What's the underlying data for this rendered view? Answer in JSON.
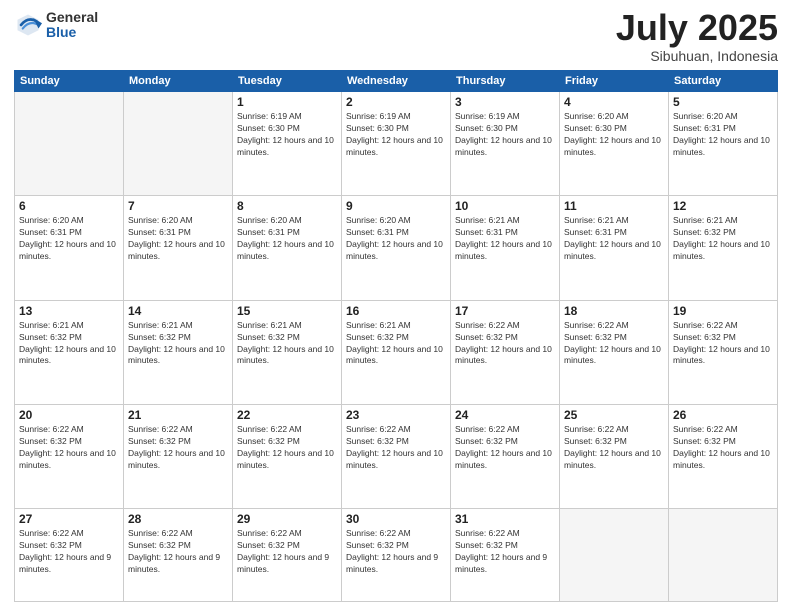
{
  "logo": {
    "general": "General",
    "blue": "Blue"
  },
  "header": {
    "month": "July 2025",
    "location": "Sibuhuan, Indonesia"
  },
  "days_of_week": [
    "Sunday",
    "Monday",
    "Tuesday",
    "Wednesday",
    "Thursday",
    "Friday",
    "Saturday"
  ],
  "weeks": [
    [
      {
        "day": "",
        "info": ""
      },
      {
        "day": "",
        "info": ""
      },
      {
        "day": "1",
        "info": "Sunrise: 6:19 AM\nSunset: 6:30 PM\nDaylight: 12 hours and 10 minutes."
      },
      {
        "day": "2",
        "info": "Sunrise: 6:19 AM\nSunset: 6:30 PM\nDaylight: 12 hours and 10 minutes."
      },
      {
        "day": "3",
        "info": "Sunrise: 6:19 AM\nSunset: 6:30 PM\nDaylight: 12 hours and 10 minutes."
      },
      {
        "day": "4",
        "info": "Sunrise: 6:20 AM\nSunset: 6:30 PM\nDaylight: 12 hours and 10 minutes."
      },
      {
        "day": "5",
        "info": "Sunrise: 6:20 AM\nSunset: 6:31 PM\nDaylight: 12 hours and 10 minutes."
      }
    ],
    [
      {
        "day": "6",
        "info": "Sunrise: 6:20 AM\nSunset: 6:31 PM\nDaylight: 12 hours and 10 minutes."
      },
      {
        "day": "7",
        "info": "Sunrise: 6:20 AM\nSunset: 6:31 PM\nDaylight: 12 hours and 10 minutes."
      },
      {
        "day": "8",
        "info": "Sunrise: 6:20 AM\nSunset: 6:31 PM\nDaylight: 12 hours and 10 minutes."
      },
      {
        "day": "9",
        "info": "Sunrise: 6:20 AM\nSunset: 6:31 PM\nDaylight: 12 hours and 10 minutes."
      },
      {
        "day": "10",
        "info": "Sunrise: 6:21 AM\nSunset: 6:31 PM\nDaylight: 12 hours and 10 minutes."
      },
      {
        "day": "11",
        "info": "Sunrise: 6:21 AM\nSunset: 6:31 PM\nDaylight: 12 hours and 10 minutes."
      },
      {
        "day": "12",
        "info": "Sunrise: 6:21 AM\nSunset: 6:32 PM\nDaylight: 12 hours and 10 minutes."
      }
    ],
    [
      {
        "day": "13",
        "info": "Sunrise: 6:21 AM\nSunset: 6:32 PM\nDaylight: 12 hours and 10 minutes."
      },
      {
        "day": "14",
        "info": "Sunrise: 6:21 AM\nSunset: 6:32 PM\nDaylight: 12 hours and 10 minutes."
      },
      {
        "day": "15",
        "info": "Sunrise: 6:21 AM\nSunset: 6:32 PM\nDaylight: 12 hours and 10 minutes."
      },
      {
        "day": "16",
        "info": "Sunrise: 6:21 AM\nSunset: 6:32 PM\nDaylight: 12 hours and 10 minutes."
      },
      {
        "day": "17",
        "info": "Sunrise: 6:22 AM\nSunset: 6:32 PM\nDaylight: 12 hours and 10 minutes."
      },
      {
        "day": "18",
        "info": "Sunrise: 6:22 AM\nSunset: 6:32 PM\nDaylight: 12 hours and 10 minutes."
      },
      {
        "day": "19",
        "info": "Sunrise: 6:22 AM\nSunset: 6:32 PM\nDaylight: 12 hours and 10 minutes."
      }
    ],
    [
      {
        "day": "20",
        "info": "Sunrise: 6:22 AM\nSunset: 6:32 PM\nDaylight: 12 hours and 10 minutes."
      },
      {
        "day": "21",
        "info": "Sunrise: 6:22 AM\nSunset: 6:32 PM\nDaylight: 12 hours and 10 minutes."
      },
      {
        "day": "22",
        "info": "Sunrise: 6:22 AM\nSunset: 6:32 PM\nDaylight: 12 hours and 10 minutes."
      },
      {
        "day": "23",
        "info": "Sunrise: 6:22 AM\nSunset: 6:32 PM\nDaylight: 12 hours and 10 minutes."
      },
      {
        "day": "24",
        "info": "Sunrise: 6:22 AM\nSunset: 6:32 PM\nDaylight: 12 hours and 10 minutes."
      },
      {
        "day": "25",
        "info": "Sunrise: 6:22 AM\nSunset: 6:32 PM\nDaylight: 12 hours and 10 minutes."
      },
      {
        "day": "26",
        "info": "Sunrise: 6:22 AM\nSunset: 6:32 PM\nDaylight: 12 hours and 10 minutes."
      }
    ],
    [
      {
        "day": "27",
        "info": "Sunrise: 6:22 AM\nSunset: 6:32 PM\nDaylight: 12 hours and 9 minutes."
      },
      {
        "day": "28",
        "info": "Sunrise: 6:22 AM\nSunset: 6:32 PM\nDaylight: 12 hours and 9 minutes."
      },
      {
        "day": "29",
        "info": "Sunrise: 6:22 AM\nSunset: 6:32 PM\nDaylight: 12 hours and 9 minutes."
      },
      {
        "day": "30",
        "info": "Sunrise: 6:22 AM\nSunset: 6:32 PM\nDaylight: 12 hours and 9 minutes."
      },
      {
        "day": "31",
        "info": "Sunrise: 6:22 AM\nSunset: 6:32 PM\nDaylight: 12 hours and 9 minutes."
      },
      {
        "day": "",
        "info": ""
      },
      {
        "day": "",
        "info": ""
      }
    ]
  ]
}
